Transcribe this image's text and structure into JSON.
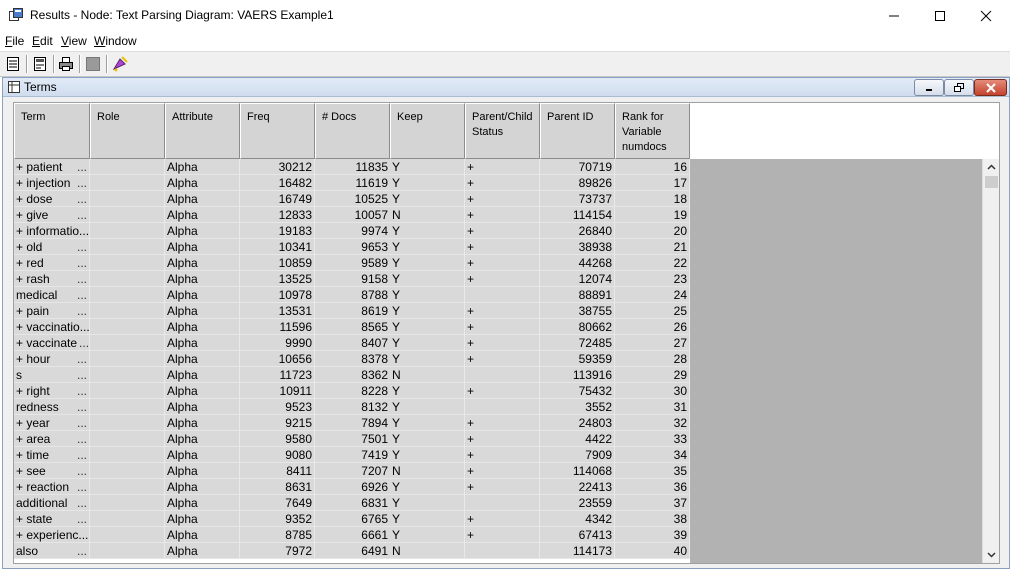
{
  "window": {
    "title": "Results - Node: Text Parsing  Diagram: VAERS Example1"
  },
  "menu": {
    "items": [
      {
        "label": "File",
        "accel": "F",
        "rest": "ile"
      },
      {
        "label": "Edit",
        "accel": "E",
        "rest": "dit"
      },
      {
        "label": "View",
        "accel": "V",
        "rest": "iew"
      },
      {
        "label": "Window",
        "accel": "W",
        "rest": "indow"
      }
    ]
  },
  "toolbar": {
    "icons": [
      "new-document-icon",
      "properties-icon",
      "print-icon",
      "disabled-icon",
      "paint-icon"
    ]
  },
  "panel": {
    "title": "Terms"
  },
  "table": {
    "columns": [
      "Term",
      "Role",
      "Attribute",
      "Freq",
      "# Docs",
      "Keep",
      "Parent/Child\nStatus",
      "Parent ID",
      "Rank for\nVariable\nnumdocs"
    ],
    "rows": [
      {
        "term": "+ patient",
        "role": "",
        "attribute": "Alpha",
        "freq": "30212",
        "docs": "11835",
        "keep": "Y",
        "status": "+",
        "parent_id": "70719",
        "rank": "16"
      },
      {
        "term": "+ injection",
        "role": "",
        "attribute": "Alpha",
        "freq": "16482",
        "docs": "11619",
        "keep": "Y",
        "status": "+",
        "parent_id": "89826",
        "rank": "17"
      },
      {
        "term": "+ dose",
        "role": "",
        "attribute": "Alpha",
        "freq": "16749",
        "docs": "10525",
        "keep": "Y",
        "status": "+",
        "parent_id": "73737",
        "rank": "18"
      },
      {
        "term": "+ give",
        "role": "",
        "attribute": "Alpha",
        "freq": "12833",
        "docs": "10057",
        "keep": "N",
        "status": "+",
        "parent_id": "114154",
        "rank": "19"
      },
      {
        "term": "+ informatio...",
        "role": "",
        "attribute": "Alpha",
        "freq": "19183",
        "docs": "9974",
        "keep": "Y",
        "status": "+",
        "parent_id": "26840",
        "rank": "20"
      },
      {
        "term": "+ old",
        "role": "",
        "attribute": "Alpha",
        "freq": "10341",
        "docs": "9653",
        "keep": "Y",
        "status": "+",
        "parent_id": "38938",
        "rank": "21"
      },
      {
        "term": "+ red",
        "role": "",
        "attribute": "Alpha",
        "freq": "10859",
        "docs": "9589",
        "keep": "Y",
        "status": "+",
        "parent_id": "44268",
        "rank": "22"
      },
      {
        "term": "+ rash",
        "role": "",
        "attribute": "Alpha",
        "freq": "13525",
        "docs": "9158",
        "keep": "Y",
        "status": "+",
        "parent_id": "12074",
        "rank": "23"
      },
      {
        "term": "medical",
        "role": "",
        "attribute": "Alpha",
        "freq": "10978",
        "docs": "8788",
        "keep": "Y",
        "status": "",
        "parent_id": "88891",
        "rank": "24"
      },
      {
        "term": "+ pain",
        "role": "",
        "attribute": "Alpha",
        "freq": "13531",
        "docs": "8619",
        "keep": "Y",
        "status": "+",
        "parent_id": "38755",
        "rank": "25"
      },
      {
        "term": "+ vaccinatio...",
        "role": "",
        "attribute": "Alpha",
        "freq": "11596",
        "docs": "8565",
        "keep": "Y",
        "status": "+",
        "parent_id": "80662",
        "rank": "26"
      },
      {
        "term": "+ vaccinate",
        "role": "",
        "attribute": "Alpha",
        "freq": "9990",
        "docs": "8407",
        "keep": "Y",
        "status": "+",
        "parent_id": "72485",
        "rank": "27"
      },
      {
        "term": "+ hour",
        "role": "",
        "attribute": "Alpha",
        "freq": "10656",
        "docs": "8378",
        "keep": "Y",
        "status": "+",
        "parent_id": "59359",
        "rank": "28"
      },
      {
        "term": "s",
        "role": "",
        "attribute": "Alpha",
        "freq": "11723",
        "docs": "8362",
        "keep": "N",
        "status": "",
        "parent_id": "113916",
        "rank": "29"
      },
      {
        "term": "+ right",
        "role": "",
        "attribute": "Alpha",
        "freq": "10911",
        "docs": "8228",
        "keep": "Y",
        "status": "+",
        "parent_id": "75432",
        "rank": "30"
      },
      {
        "term": "redness",
        "role": "",
        "attribute": "Alpha",
        "freq": "9523",
        "docs": "8132",
        "keep": "Y",
        "status": "",
        "parent_id": "3552",
        "rank": "31"
      },
      {
        "term": "+ year",
        "role": "",
        "attribute": "Alpha",
        "freq": "9215",
        "docs": "7894",
        "keep": "Y",
        "status": "+",
        "parent_id": "24803",
        "rank": "32"
      },
      {
        "term": "+ area",
        "role": "",
        "attribute": "Alpha",
        "freq": "9580",
        "docs": "7501",
        "keep": "Y",
        "status": "+",
        "parent_id": "4422",
        "rank": "33"
      },
      {
        "term": "+ time",
        "role": "",
        "attribute": "Alpha",
        "freq": "9080",
        "docs": "7419",
        "keep": "Y",
        "status": "+",
        "parent_id": "7909",
        "rank": "34"
      },
      {
        "term": "+ see",
        "role": "",
        "attribute": "Alpha",
        "freq": "8411",
        "docs": "7207",
        "keep": "N",
        "status": "+",
        "parent_id": "114068",
        "rank": "35"
      },
      {
        "term": "+ reaction",
        "role": "",
        "attribute": "Alpha",
        "freq": "8631",
        "docs": "6926",
        "keep": "Y",
        "status": "+",
        "parent_id": "22413",
        "rank": "36"
      },
      {
        "term": "additional",
        "role": "",
        "attribute": "Alpha",
        "freq": "7649",
        "docs": "6831",
        "keep": "Y",
        "status": "",
        "parent_id": "23559",
        "rank": "37"
      },
      {
        "term": "+ state",
        "role": "",
        "attribute": "Alpha",
        "freq": "9352",
        "docs": "6765",
        "keep": "Y",
        "status": "+",
        "parent_id": "4342",
        "rank": "38"
      },
      {
        "term": "+ experienc...",
        "role": "",
        "attribute": "Alpha",
        "freq": "8785",
        "docs": "6661",
        "keep": "Y",
        "status": "+",
        "parent_id": "67413",
        "rank": "39"
      },
      {
        "term": "also",
        "role": "",
        "attribute": "Alpha",
        "freq": "7972",
        "docs": "6491",
        "keep": "N",
        "status": "",
        "parent_id": "114173",
        "rank": "40"
      }
    ]
  }
}
